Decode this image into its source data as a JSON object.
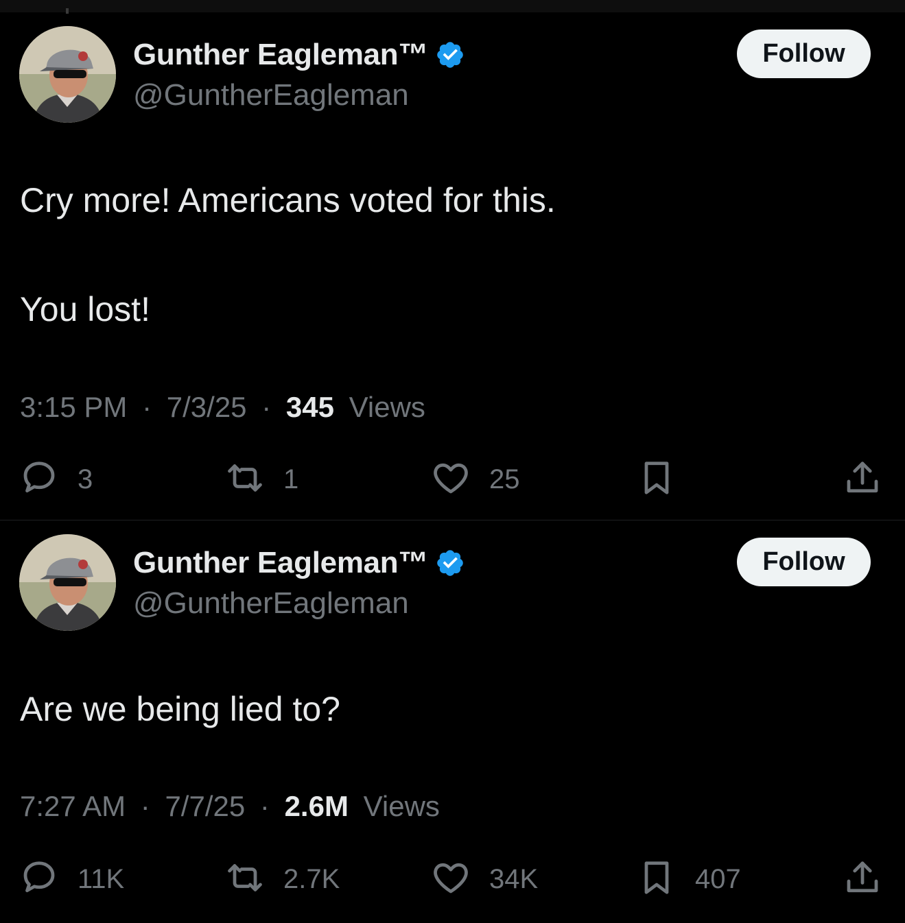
{
  "tweets": [
    {
      "display_name": "Gunther Eagleman™",
      "handle": "@GuntherEagleman",
      "follow_label": "Follow",
      "text_lines": [
        "Cry more!  Americans voted for this.",
        "You lost!"
      ],
      "time": "3:15 PM",
      "date": "7/3/25",
      "views_count": "345",
      "views_label": "Views",
      "stats": {
        "replies": "3",
        "reposts": "1",
        "likes": "25",
        "bookmarks": ""
      }
    },
    {
      "display_name": "Gunther Eagleman™",
      "handle": "@GuntherEagleman",
      "follow_label": "Follow",
      "text_lines": [
        "Are we being lied to?"
      ],
      "time": "7:27 AM",
      "date": "7/7/25",
      "views_count": "2.6M",
      "views_label": "Views",
      "stats": {
        "replies": "11K",
        "reposts": "2.7K",
        "likes": "34K",
        "bookmarks": "407"
      }
    }
  ],
  "separator": "·",
  "icons": [
    "avatar",
    "verified-badge-icon",
    "reply-icon",
    "repost-icon",
    "like-icon",
    "bookmark-icon",
    "share-icon"
  ],
  "colors": {
    "background": "#000000",
    "text": "#e7e9ea",
    "muted": "#71767b",
    "verified": "#1d9bf0",
    "button": "#eff3f4"
  }
}
